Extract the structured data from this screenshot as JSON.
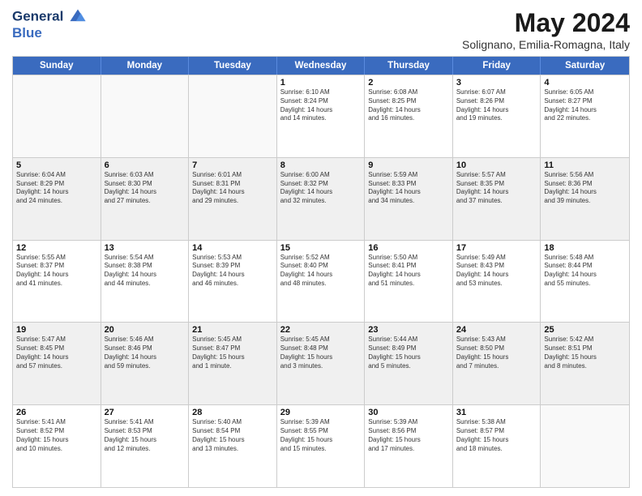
{
  "header": {
    "logo_line1": "General",
    "logo_line2": "Blue",
    "title": "May 2024",
    "subtitle": "Solignano, Emilia-Romagna, Italy"
  },
  "days": [
    "Sunday",
    "Monday",
    "Tuesday",
    "Wednesday",
    "Thursday",
    "Friday",
    "Saturday"
  ],
  "rows": [
    [
      {
        "day": "",
        "info": ""
      },
      {
        "day": "",
        "info": ""
      },
      {
        "day": "",
        "info": ""
      },
      {
        "day": "1",
        "info": "Sunrise: 6:10 AM\nSunset: 8:24 PM\nDaylight: 14 hours\nand 14 minutes."
      },
      {
        "day": "2",
        "info": "Sunrise: 6:08 AM\nSunset: 8:25 PM\nDaylight: 14 hours\nand 16 minutes."
      },
      {
        "day": "3",
        "info": "Sunrise: 6:07 AM\nSunset: 8:26 PM\nDaylight: 14 hours\nand 19 minutes."
      },
      {
        "day": "4",
        "info": "Sunrise: 6:05 AM\nSunset: 8:27 PM\nDaylight: 14 hours\nand 22 minutes."
      }
    ],
    [
      {
        "day": "5",
        "info": "Sunrise: 6:04 AM\nSunset: 8:29 PM\nDaylight: 14 hours\nand 24 minutes."
      },
      {
        "day": "6",
        "info": "Sunrise: 6:03 AM\nSunset: 8:30 PM\nDaylight: 14 hours\nand 27 minutes."
      },
      {
        "day": "7",
        "info": "Sunrise: 6:01 AM\nSunset: 8:31 PM\nDaylight: 14 hours\nand 29 minutes."
      },
      {
        "day": "8",
        "info": "Sunrise: 6:00 AM\nSunset: 8:32 PM\nDaylight: 14 hours\nand 32 minutes."
      },
      {
        "day": "9",
        "info": "Sunrise: 5:59 AM\nSunset: 8:33 PM\nDaylight: 14 hours\nand 34 minutes."
      },
      {
        "day": "10",
        "info": "Sunrise: 5:57 AM\nSunset: 8:35 PM\nDaylight: 14 hours\nand 37 minutes."
      },
      {
        "day": "11",
        "info": "Sunrise: 5:56 AM\nSunset: 8:36 PM\nDaylight: 14 hours\nand 39 minutes."
      }
    ],
    [
      {
        "day": "12",
        "info": "Sunrise: 5:55 AM\nSunset: 8:37 PM\nDaylight: 14 hours\nand 41 minutes."
      },
      {
        "day": "13",
        "info": "Sunrise: 5:54 AM\nSunset: 8:38 PM\nDaylight: 14 hours\nand 44 minutes."
      },
      {
        "day": "14",
        "info": "Sunrise: 5:53 AM\nSunset: 8:39 PM\nDaylight: 14 hours\nand 46 minutes."
      },
      {
        "day": "15",
        "info": "Sunrise: 5:52 AM\nSunset: 8:40 PM\nDaylight: 14 hours\nand 48 minutes."
      },
      {
        "day": "16",
        "info": "Sunrise: 5:50 AM\nSunset: 8:41 PM\nDaylight: 14 hours\nand 51 minutes."
      },
      {
        "day": "17",
        "info": "Sunrise: 5:49 AM\nSunset: 8:43 PM\nDaylight: 14 hours\nand 53 minutes."
      },
      {
        "day": "18",
        "info": "Sunrise: 5:48 AM\nSunset: 8:44 PM\nDaylight: 14 hours\nand 55 minutes."
      }
    ],
    [
      {
        "day": "19",
        "info": "Sunrise: 5:47 AM\nSunset: 8:45 PM\nDaylight: 14 hours\nand 57 minutes."
      },
      {
        "day": "20",
        "info": "Sunrise: 5:46 AM\nSunset: 8:46 PM\nDaylight: 14 hours\nand 59 minutes."
      },
      {
        "day": "21",
        "info": "Sunrise: 5:45 AM\nSunset: 8:47 PM\nDaylight: 15 hours\nand 1 minute."
      },
      {
        "day": "22",
        "info": "Sunrise: 5:45 AM\nSunset: 8:48 PM\nDaylight: 15 hours\nand 3 minutes."
      },
      {
        "day": "23",
        "info": "Sunrise: 5:44 AM\nSunset: 8:49 PM\nDaylight: 15 hours\nand 5 minutes."
      },
      {
        "day": "24",
        "info": "Sunrise: 5:43 AM\nSunset: 8:50 PM\nDaylight: 15 hours\nand 7 minutes."
      },
      {
        "day": "25",
        "info": "Sunrise: 5:42 AM\nSunset: 8:51 PM\nDaylight: 15 hours\nand 8 minutes."
      }
    ],
    [
      {
        "day": "26",
        "info": "Sunrise: 5:41 AM\nSunset: 8:52 PM\nDaylight: 15 hours\nand 10 minutes."
      },
      {
        "day": "27",
        "info": "Sunrise: 5:41 AM\nSunset: 8:53 PM\nDaylight: 15 hours\nand 12 minutes."
      },
      {
        "day": "28",
        "info": "Sunrise: 5:40 AM\nSunset: 8:54 PM\nDaylight: 15 hours\nand 13 minutes."
      },
      {
        "day": "29",
        "info": "Sunrise: 5:39 AM\nSunset: 8:55 PM\nDaylight: 15 hours\nand 15 minutes."
      },
      {
        "day": "30",
        "info": "Sunrise: 5:39 AM\nSunset: 8:56 PM\nDaylight: 15 hours\nand 17 minutes."
      },
      {
        "day": "31",
        "info": "Sunrise: 5:38 AM\nSunset: 8:57 PM\nDaylight: 15 hours\nand 18 minutes."
      },
      {
        "day": "",
        "info": ""
      }
    ]
  ]
}
